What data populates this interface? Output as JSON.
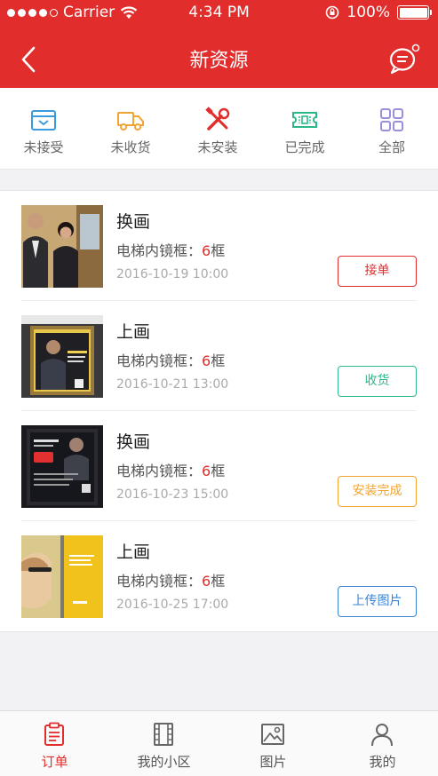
{
  "status_bar": {
    "carrier": "Carrier",
    "time": "4:34 PM",
    "battery": "100%"
  },
  "nav": {
    "title": "新资源"
  },
  "tabs": [
    {
      "label": "未接受",
      "icon": "inbox-icon"
    },
    {
      "label": "未收货",
      "icon": "truck-icon"
    },
    {
      "label": "未安装",
      "icon": "tools-icon"
    },
    {
      "label": "已完成",
      "icon": "ticket-icon"
    },
    {
      "label": "全部",
      "icon": "grid-icon"
    }
  ],
  "items": [
    {
      "title": "换画",
      "meta_label": "电梯内镜框：",
      "meta_num": "6",
      "meta_unit": "框",
      "date": "2016-10-19 10:00",
      "action": "接单"
    },
    {
      "title": "上画",
      "meta_label": "电梯内镜框：",
      "meta_num": "6",
      "meta_unit": "框",
      "date": "2016-10-21 13:00",
      "action": "收货"
    },
    {
      "title": "换画",
      "meta_label": "电梯内镜框：",
      "meta_num": "6",
      "meta_unit": "框",
      "date": "2016-10-23 15:00",
      "action": "安装完成"
    },
    {
      "title": "上画",
      "meta_label": "电梯内镜框：",
      "meta_num": "6",
      "meta_unit": "框",
      "date": "2016-10-25 17:00",
      "action": "上传图片"
    }
  ],
  "tabbar": [
    {
      "label": "订单",
      "icon": "clipboard-icon"
    },
    {
      "label": "我的小区",
      "icon": "film-icon"
    },
    {
      "label": "图片",
      "icon": "image-icon"
    },
    {
      "label": "我的",
      "icon": "user-icon"
    }
  ],
  "colors": {
    "brand": "#e22d2d",
    "green": "#2ab88a",
    "orange": "#f0a432",
    "blue": "#3a85d6"
  }
}
